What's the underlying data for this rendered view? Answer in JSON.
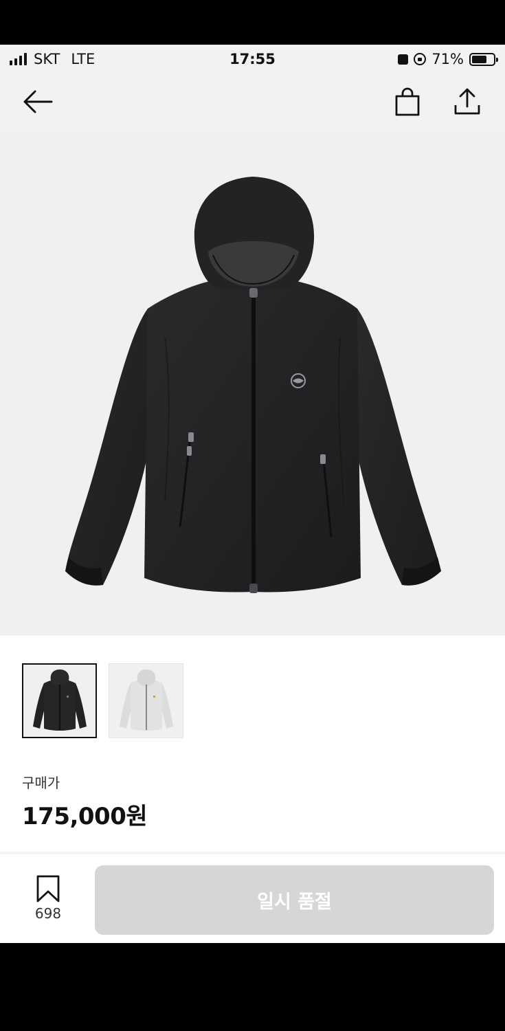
{
  "status_bar": {
    "carrier": "SKT",
    "network": "LTE",
    "time": "17:55",
    "battery": "71%",
    "battery_level": 0.71
  },
  "nav": {
    "icons": [
      "back-arrow-icon",
      "shopping-bag-icon",
      "share-icon"
    ]
  },
  "product": {
    "hero_image": "black-hooded-windbreaker-jacket",
    "thumbnails": [
      {
        "variant": "black",
        "selected": true
      },
      {
        "variant": "light-gray",
        "selected": false
      }
    ],
    "price_label": "구매가",
    "price": "175,000원"
  },
  "action_bar": {
    "bookmark_count": "698",
    "buy_button_label": "일시 품절",
    "buy_button_color": "#d6d6d6"
  },
  "colors": {
    "background": "#ffffff",
    "nav_background": "#f2f2f2",
    "text": "#111111",
    "disabled_button": "#d6d6d6"
  }
}
